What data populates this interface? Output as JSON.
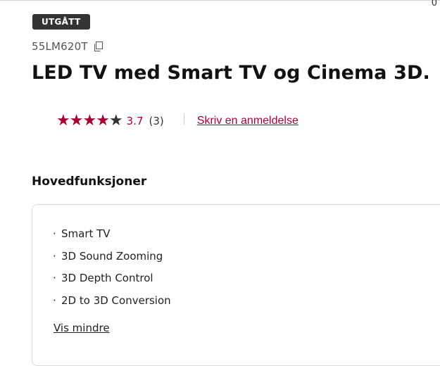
{
  "corner_count": "0",
  "badge": "UTGÅTT",
  "model": "55LM620T",
  "title": "LED TV med Smart TV og Cinema 3D.",
  "rating": {
    "stars_filled": 4,
    "stars_total": 5,
    "value": "3.7",
    "count": "(3)",
    "accent_color": "#a50034"
  },
  "review_link": "Skriv en anmeldelse",
  "section_title": "Hovedfunksjoner",
  "features": [
    "Smart TV",
    "3D Sound Zooming",
    "3D Depth Control",
    "2D to 3D Conversion"
  ],
  "toggle_label": "Vis mindre",
  "icons": {
    "copy": "copy-icon",
    "star": "star-icon"
  }
}
